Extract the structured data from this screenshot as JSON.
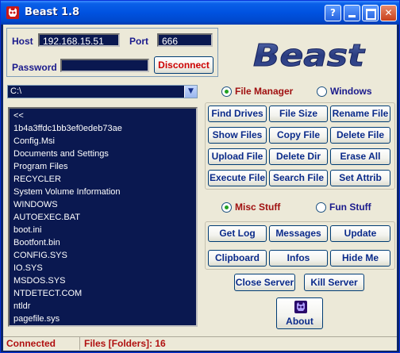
{
  "window": {
    "title": "Beast 1.8"
  },
  "connection": {
    "host_label": "Host",
    "host_value": "192.168.15.51",
    "port_label": "Port",
    "port_value": "666",
    "password_label": "Password",
    "password_value": "",
    "disconnect_label": "Disconnect"
  },
  "logo_text": "Beast",
  "path_value": "C:\\",
  "file_list": [
    "<<",
    "1b4a3ffdc1bb3ef0edeb73ae",
    "Config.Msi",
    "Documents and Settings",
    "Program Files",
    "RECYCLER",
    "System Volume Information",
    "WINDOWS",
    "AUTOEXEC.BAT",
    "boot.ini",
    "Bootfont.bin",
    "CONFIG.SYS",
    "IO.SYS",
    "MSDOS.SYS",
    "NTDETECT.COM",
    "ntldr",
    "pagefile.sys"
  ],
  "mode_radios": {
    "file_manager": "File Manager",
    "windows": "Windows",
    "selected": "file_manager"
  },
  "file_buttons": [
    "Find Drives",
    "File Size",
    "Rename File",
    "Show Files",
    "Copy File",
    "Delete File",
    "Upload File",
    "Delete Dir",
    "Erase All",
    "Execute File",
    "Search File",
    "Set Attrib"
  ],
  "stuff_radios": {
    "misc": "Misc Stuff",
    "fun": "Fun Stuff",
    "selected": "misc"
  },
  "misc_buttons": [
    "Get Log",
    "Messages",
    "Update",
    "Clipboard",
    "Infos",
    "Hide Me"
  ],
  "server_buttons": {
    "close": "Close Server",
    "kill": "Kill Server"
  },
  "about_label": "About",
  "status": {
    "connection": "Connected",
    "files": "Files [Folders]: 16"
  },
  "colors": {
    "field_bg": "#0a1850",
    "accent_red": "#cc0000",
    "label_blue": "#1a1a8c",
    "radio_dot": "#21a121"
  },
  "icons": {
    "app": "beast-skull-icon",
    "about": "beast-skull-icon"
  }
}
